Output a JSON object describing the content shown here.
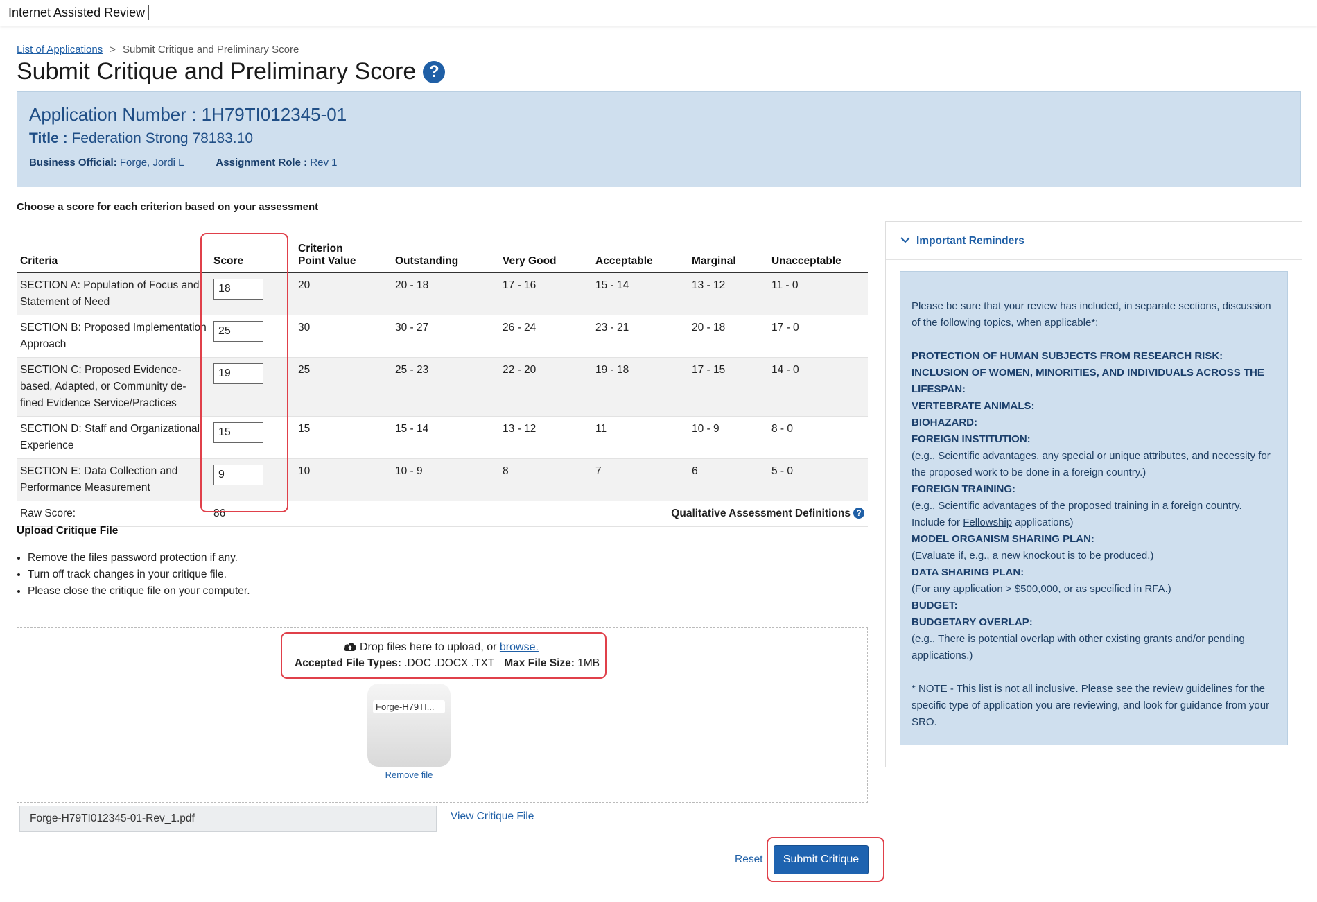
{
  "app": {
    "name": "Internet Assisted Review"
  },
  "breadcrumb": {
    "link": "List of Applications",
    "separator": ">",
    "current": "Submit Critique and Preliminary Score"
  },
  "page": {
    "title": "Submit Critique and Preliminary Score",
    "help_glyph": "?"
  },
  "application": {
    "number_label": "Application Number :",
    "number": "1H79TI012345-01",
    "title_label": "Title :",
    "title": "Federation Strong 78183.10",
    "business_official_label": "Business Official:",
    "business_official": "Forge, Jordi L",
    "role_label": "Assignment Role :",
    "role": "Rev 1"
  },
  "instructions": "Choose a score for each criterion based on your assessment",
  "table": {
    "headers": {
      "criteria": "Criteria",
      "score": "Score",
      "point_value_1": "Criterion",
      "point_value_2": "Point Value",
      "outstanding": "Outstanding",
      "very_good": "Very Good",
      "acceptable": "Acceptable",
      "marginal": "Marginal",
      "unacceptable": "Unacceptable"
    },
    "rows": [
      {
        "criteria": "SECTION A: Population of Focus and Statement of Need",
        "score": "18",
        "point_value": "20",
        "outstanding": "20 - 18",
        "very_good": "17 - 16",
        "acceptable": "15 - 14",
        "marginal": "13 - 12",
        "unacceptable": "11 - 0"
      },
      {
        "criteria": "SECTION B: Proposed Implementation Approach",
        "score": "25",
        "point_value": "30",
        "outstanding": "30 - 27",
        "very_good": "26 - 24",
        "acceptable": "23 - 21",
        "marginal": "20 - 18",
        "unacceptable": "17 - 0"
      },
      {
        "criteria": "SECTION C: Proposed Evidence-based, Adapted, or Community de-fined Evidence Service/Practices",
        "score": "19",
        "point_value": "25",
        "outstanding": "25 - 23",
        "very_good": "22 - 20",
        "acceptable": "19 - 18",
        "marginal": "17 - 15",
        "unacceptable": "14 - 0"
      },
      {
        "criteria": "SECTION D: Staff and Organizational Experience",
        "score": "15",
        "point_value": "15",
        "outstanding": "15 - 14",
        "very_good": "13 - 12",
        "acceptable": "11",
        "marginal": "10 - 9",
        "unacceptable": "8 - 0"
      },
      {
        "criteria": "SECTION E: Data Collection and Performance Measurement",
        "score": "9",
        "point_value": "10",
        "outstanding": "10 - 9",
        "very_good": "8",
        "acceptable": "7",
        "marginal": "6",
        "unacceptable": "5 - 0"
      }
    ],
    "raw_score_label": "Raw Score:",
    "raw_score": "86",
    "qualitative_link": "Qualitative Assessment Definitions",
    "help_glyph": "?"
  },
  "upload": {
    "heading": "Upload Critique File",
    "notes": [
      "Remove the files password protection if any.",
      "Turn off track changes in your critique file.",
      "Please close the critique file on your computer."
    ],
    "drop_text": "Drop files here to upload, or",
    "browse": "browse.",
    "types_label": "Accepted File Types:",
    "types": ".DOC .DOCX .TXT",
    "size_label": "Max File Size:",
    "size": "1MB",
    "thumb_name": "Forge-H79TI...",
    "remove": "Remove file",
    "filename": "Forge-H79TI012345-01-Rev_1.pdf",
    "view": "View Critique File"
  },
  "actions": {
    "reset": "Reset",
    "submit": "Submit Critique"
  },
  "reminders": {
    "title": "Important Reminders",
    "intro": "Please be sure that your review has included, in separate sections, discussion of the following topics, when applicable*:",
    "h1": "PROTECTION OF HUMAN SUBJECTS FROM RESEARCH RISK:",
    "h2": "INCLUSION OF WOMEN, MINORITIES, AND INDIVIDUALS ACROSS THE LIFESPAN:",
    "h3": "VERTEBRATE ANIMALS:",
    "h4": "BIOHAZARD:",
    "h5": "FOREIGN INSTITUTION:",
    "t5": "(e.g., Scientific advantages, any special or unique attributes, and necessity for the proposed work to be done in a foreign country.)",
    "h6": "FOREIGN TRAINING:",
    "t6a": "(e.g., Scientific advantages of the proposed training in a foreign country. Include for",
    "t6link": "Fellowship",
    "t6b": "applications)",
    "h7": "MODEL ORGANISM SHARING PLAN:",
    "t7": "(Evaluate if, e.g., a new knockout is to be produced.)",
    "h8": "DATA SHARING PLAN:",
    "t8": "(For any application > $500,000, or as specified in RFA.)",
    "h9": "BUDGET:",
    "h10": "BUDGETARY OVERLAP:",
    "t10": "(e.g., There is potential overlap with other existing grants and/or pending applications.)",
    "note": "* NOTE - This list is not all inclusive. Please see the review guidelines for the specific type of application you are reviewing, and look for guidance from your SRO."
  },
  "colors": {
    "link": "#1f5fa6",
    "panel": "#cfdfee",
    "primary_button": "#1e63b0",
    "highlight": "#e0404a"
  }
}
